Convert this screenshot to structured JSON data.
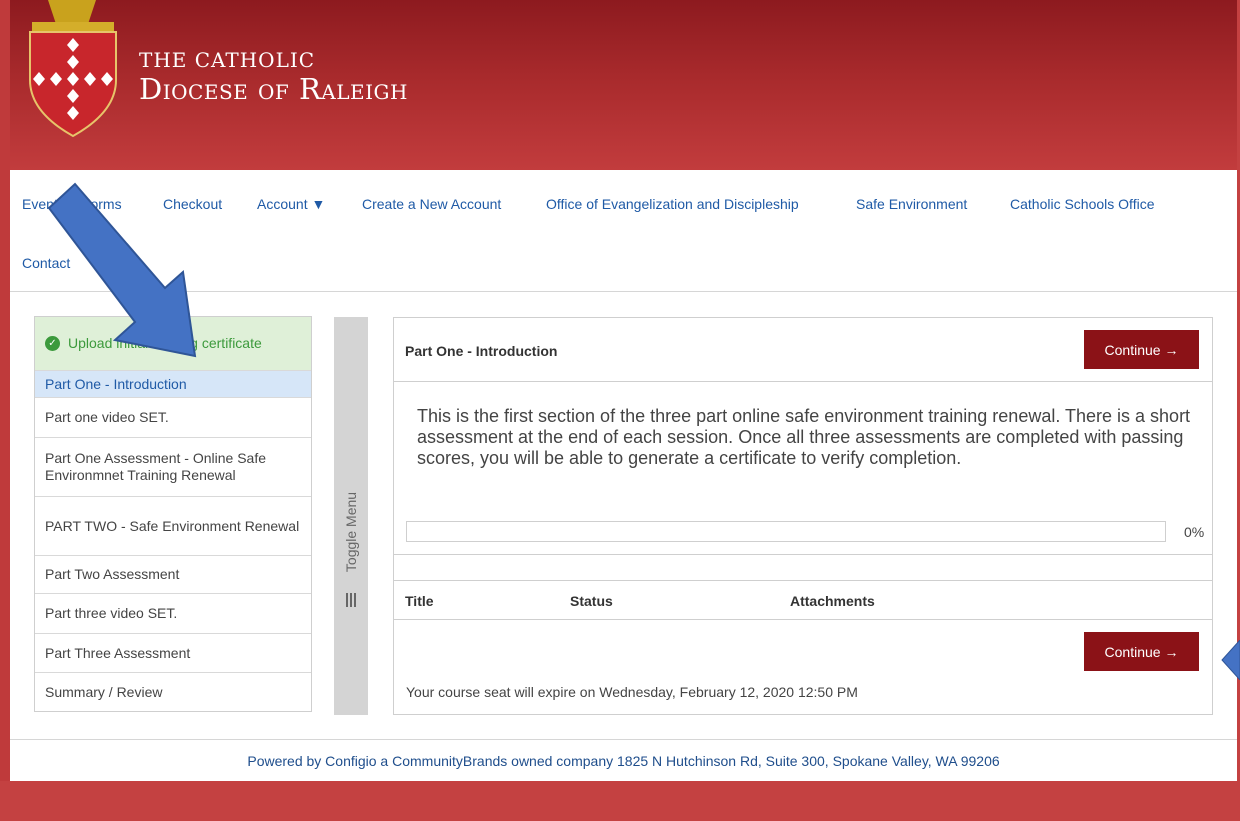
{
  "header": {
    "title_small": "THE CATHOLIC",
    "title_big": "Diocese of Raleigh",
    "colors": {
      "header_top": "#8d1a1f",
      "header_bottom": "#c23c3d",
      "accent": "#8b1217"
    }
  },
  "nav": {
    "items": [
      {
        "label": "Events & Forms"
      },
      {
        "label": "Checkout"
      },
      {
        "label": "Account ▼"
      },
      {
        "label": "Create a New Account"
      },
      {
        "label": "Office of Evangelization and Discipleship"
      },
      {
        "label": "Safe Environment"
      },
      {
        "label": "Catholic Schools Office"
      },
      {
        "label": "Contact"
      }
    ]
  },
  "sidebar": {
    "items": [
      {
        "label": "Upload initial training certificate",
        "state": "completed"
      },
      {
        "label": "Part One - Introduction",
        "state": "active"
      },
      {
        "label": "Part one video SET.",
        "state": "normal"
      },
      {
        "label": "Part One Assessment - Online Safe Environmnet Training Renewal",
        "state": "normal"
      },
      {
        "label": "PART TWO - Safe Environment Renewal",
        "state": "normal"
      },
      {
        "label": "Part Two Assessment",
        "state": "normal"
      },
      {
        "label": "Part three video SET.",
        "state": "normal"
      },
      {
        "label": "Part Three Assessment",
        "state": "normal"
      },
      {
        "label": "Summary / Review",
        "state": "normal"
      }
    ],
    "toggle_label": "Toggle Menu"
  },
  "panel": {
    "title": "Part One - Introduction",
    "continue_label": "Continue →",
    "description": "This is the first section of the three part online safe environment training renewal. There is a short assessment at the end of each session.  Once all three assessments are completed with passing scores, you will be able to generate a certificate to verify completion.",
    "progress_percent": 0,
    "progress_label": "0%",
    "table_headers": [
      "Title",
      "Status",
      "Attachments"
    ],
    "expire_text": "Your course seat will expire on Wednesday, February 12, 2020 12:50 PM"
  },
  "footer": {
    "text": "Powered by Configio a CommunityBrands owned company 1825 N Hutchinson Rd, Suite 300, Spokane Valley, WA 99206"
  }
}
